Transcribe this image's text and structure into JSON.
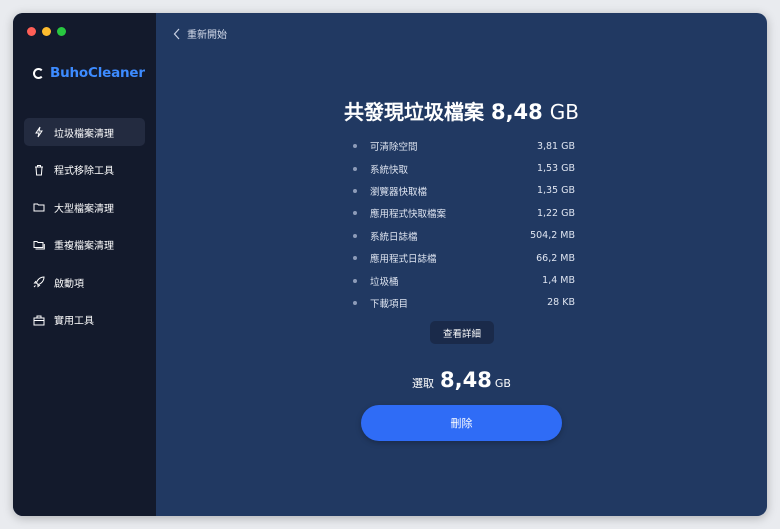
{
  "app": {
    "name": "BuhoCleaner"
  },
  "colors": {
    "close": "#ff5f57",
    "minimize": "#febc2e",
    "zoom": "#28c840",
    "accent": "#2f6cf6"
  },
  "sidebar": {
    "items": [
      {
        "label": "垃圾檔案清理",
        "icon": "bolt-icon"
      },
      {
        "label": "程式移除工具",
        "icon": "trash-icon"
      },
      {
        "label": "大型檔案清理",
        "icon": "folder-icon"
      },
      {
        "label": "重複檔案清理",
        "icon": "duplicate-folder-icon"
      },
      {
        "label": "啟動項",
        "icon": "rocket-icon"
      },
      {
        "label": "實用工具",
        "icon": "toolbox-icon"
      }
    ]
  },
  "header": {
    "back_label": "重新開始"
  },
  "summary": {
    "title_prefix": "共發現垃圾檔案",
    "total_value": "8,48",
    "total_unit": "GB",
    "items": [
      {
        "name": "可清除空間",
        "size": "3,81 GB"
      },
      {
        "name": "系統快取",
        "size": "1,53 GB"
      },
      {
        "name": "瀏覽器快取檔",
        "size": "1,35 GB"
      },
      {
        "name": "應用程式快取檔案",
        "size": "1,22 GB"
      },
      {
        "name": "系統日誌檔",
        "size": "504,2 MB"
      },
      {
        "name": "應用程式日誌檔",
        "size": "66,2 MB"
      },
      {
        "name": "垃圾桶",
        "size": "1,4 MB"
      },
      {
        "name": "下載項目",
        "size": "28 KB"
      }
    ],
    "details_label": "查看詳細",
    "selected_label": "選取",
    "selected_value": "8,48",
    "selected_unit": "GB",
    "delete_label": "刪除"
  }
}
